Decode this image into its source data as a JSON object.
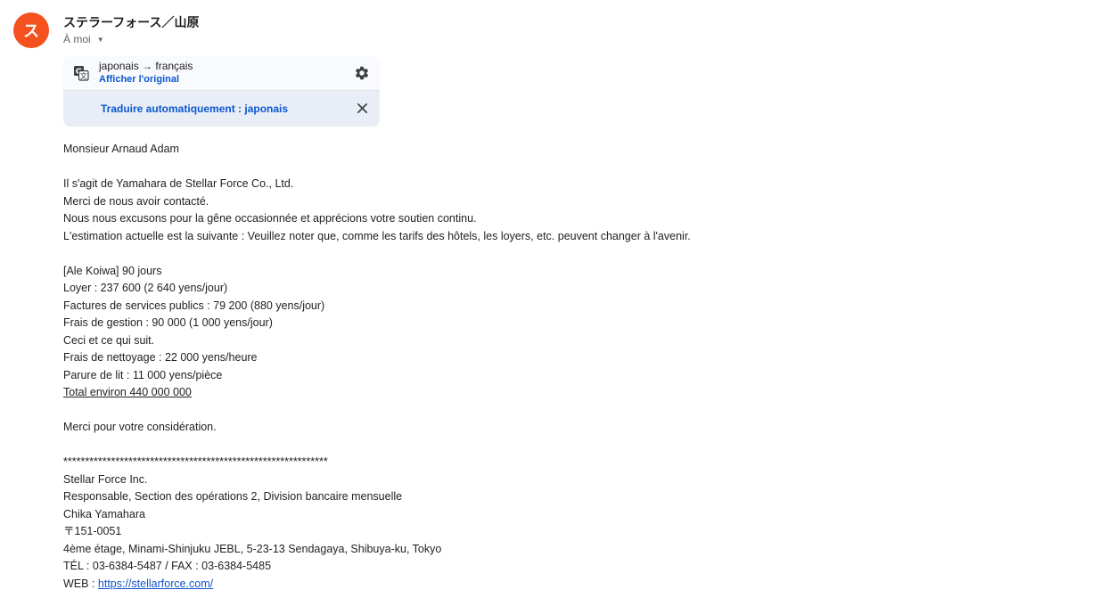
{
  "sender": {
    "avatar_letter": "ス",
    "name": "ステラーフォース／山原",
    "recipient_label": "À moi"
  },
  "translation": {
    "lang_pair": "japonais → français",
    "show_original": "Afficher l'original",
    "auto_translate": "Traduire automatiquement : japonais"
  },
  "body": {
    "greeting": "Monsieur Arnaud Adam",
    "intro": [
      "Il s'agit de Yamahara de Stellar Force Co., Ltd.",
      "Merci de nous avoir contacté.",
      "Nous nous excusons pour la gêne occasionnée et apprécions votre soutien continu.",
      "L'estimation actuelle est la suivante : Veuillez noter que, comme les tarifs des hôtels, les loyers, etc. peuvent changer à l'avenir."
    ],
    "estimate": [
      "[Ale Koiwa] 90 jours",
      "Loyer : 237 600 (2 640 yens/jour)",
      "Factures de services publics : 79 200 (880 yens/jour)",
      "Frais de gestion : 90 000 (1 000 yens/jour)",
      "Ceci et ce qui suit.",
      "Frais de nettoyage : 22 000 yens/heure",
      "Parure de lit : 11 000 yens/pièce"
    ],
    "total": "Total environ 440 000 000",
    "thanks": "Merci pour votre considération.",
    "separator": "*************************************************************",
    "signature": [
      "Stellar Force Inc.",
      "Responsable, Section des opérations 2, Division bancaire mensuelle",
      "Chika Yamahara",
      "〒151-0051",
      "4ème étage, Minami-Shinjuku JEBL, 5-23-13 Sendagaya, Shibuya-ku, Tokyo",
      "TÉL : 03-6384-5487 / FAX : 03-6384-5485"
    ],
    "web_label": "WEB : ",
    "web_url": "https://stellarforce.com/"
  },
  "colors": {
    "avatar": "#f4511e",
    "link": "#0b57d0",
    "panel": "#e9eef6"
  }
}
